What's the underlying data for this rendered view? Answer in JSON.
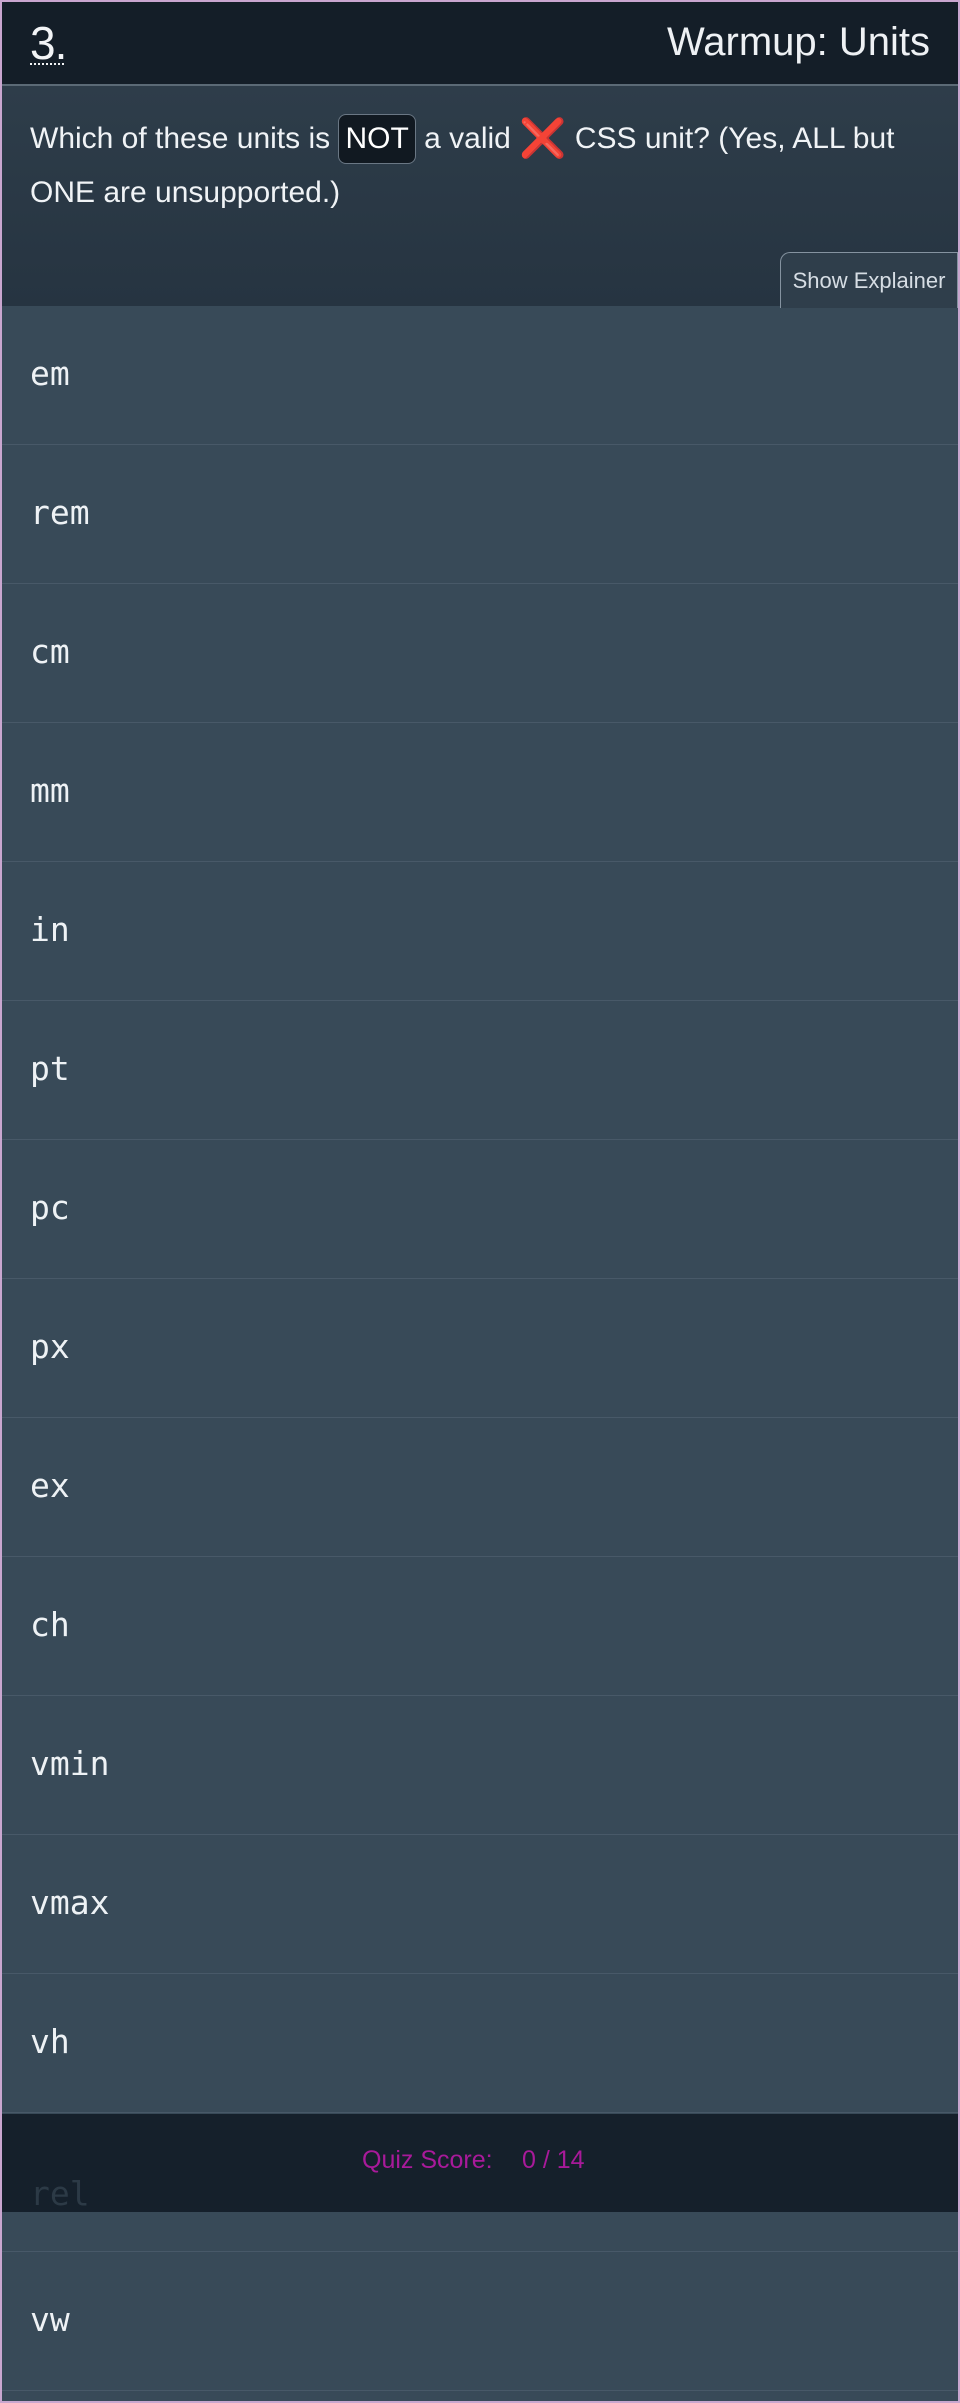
{
  "question": {
    "number": "3.",
    "title": "Warmup: Units",
    "text_before": "Which of these units is ",
    "not_badge": "NOT",
    "text_middle": " a valid ",
    "x_icon": "❌",
    "text_after": " CSS unit? (Yes, ALL but ONE are unsupported.)",
    "explainer_button": "Show Explainer"
  },
  "options": [
    "em",
    "rem",
    "cm",
    "mm",
    "in",
    "pt",
    "pc",
    "px",
    "ex",
    "ch",
    "vmin",
    "vmax",
    "vh",
    "rel",
    "vw"
  ],
  "score": {
    "label": "Quiz Score:",
    "value": "0 / 14"
  }
}
